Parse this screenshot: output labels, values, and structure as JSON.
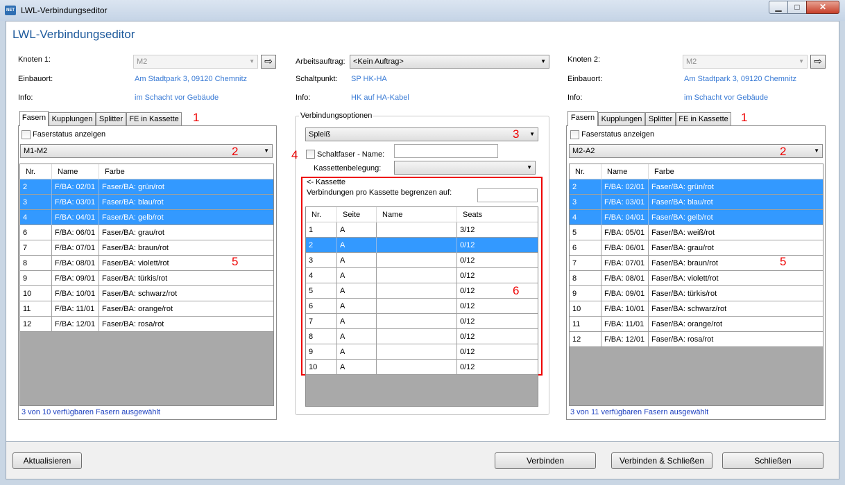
{
  "window": {
    "title": "LWL-Verbindungseditor",
    "icon_text": "NET",
    "min_glyph": "▁",
    "max_glyph": "□",
    "close_glyph": "✕"
  },
  "heading": "LWL-Verbindungseditor",
  "left": {
    "knoten_label": "Knoten 1:",
    "knoten_value": "M2",
    "einbauort_label": "Einbauort:",
    "einbauort_value": "Am Stadtpark 3, 09120 Chemnitz",
    "info_label": "Info:",
    "info_value": "im Schacht vor Gebäude",
    "tabs": [
      "Fasern",
      "Kupplungen",
      "Splitter",
      "FE in Kassette"
    ],
    "faserstatus_label": "Faserstatus anzeigen",
    "dropdown_value": "M1-M2",
    "columns": [
      "Nr.",
      "Name",
      "Farbe"
    ],
    "rows": [
      {
        "nr": "2",
        "name": "F/BA: 02/01",
        "farbe": "Faser/BA: grün/rot",
        "selected": true
      },
      {
        "nr": "3",
        "name": "F/BA: 03/01",
        "farbe": "Faser/BA: blau/rot",
        "selected": true
      },
      {
        "nr": "4",
        "name": "F/BA: 04/01",
        "farbe": "Faser/BA: gelb/rot",
        "selected": true
      },
      {
        "nr": "6",
        "name": "F/BA: 06/01",
        "farbe": "Faser/BA: grau/rot",
        "selected": false
      },
      {
        "nr": "7",
        "name": "F/BA: 07/01",
        "farbe": "Faser/BA: braun/rot",
        "selected": false
      },
      {
        "nr": "8",
        "name": "F/BA: 08/01",
        "farbe": "Faser/BA: violett/rot",
        "selected": false
      },
      {
        "nr": "9",
        "name": "F/BA: 09/01",
        "farbe": "Faser/BA: türkis/rot",
        "selected": false
      },
      {
        "nr": "10",
        "name": "F/BA: 10/01",
        "farbe": "Faser/BA: schwarz/rot",
        "selected": false
      },
      {
        "nr": "11",
        "name": "F/BA: 11/01",
        "farbe": "Faser/BA: orange/rot",
        "selected": false
      },
      {
        "nr": "12",
        "name": "F/BA: 12/01",
        "farbe": "Faser/BA: rosa/rot",
        "selected": false
      }
    ],
    "status": "3 von 10 verfügbaren Fasern ausgewählt"
  },
  "center": {
    "arbeitsauftrag_label": "Arbeitsauftrag:",
    "arbeitsauftrag_value": "<Kein Auftrag>",
    "schaltpunkt_label": "Schaltpunkt:",
    "schaltpunkt_value": "SP HK-HA",
    "info_label": "Info:",
    "info_value": "HK auf HA-Kabel",
    "group_label": "Verbindungsoptionen",
    "type_value": "Spleiß",
    "schaltfaser_label": "Schaltfaser - Name:",
    "schaltfaser_value": "",
    "kassettenbelegung_label": "Kassettenbelegung:",
    "kassettenbelegung_value": "",
    "kassette_group_label": "<- Kassette",
    "limit_label": "Verbindungen pro Kassette begrenzen auf:",
    "limit_value": "",
    "columns": [
      "Nr.",
      "Seite",
      "Name",
      "Seats"
    ],
    "rows": [
      {
        "nr": "1",
        "seite": "A",
        "name": "",
        "seats": "3/12",
        "selected": false
      },
      {
        "nr": "2",
        "seite": "A",
        "name": "",
        "seats": "0/12",
        "selected": true
      },
      {
        "nr": "3",
        "seite": "A",
        "name": "",
        "seats": "0/12",
        "selected": false
      },
      {
        "nr": "4",
        "seite": "A",
        "name": "",
        "seats": "0/12",
        "selected": false
      },
      {
        "nr": "5",
        "seite": "A",
        "name": "",
        "seats": "0/12",
        "selected": false
      },
      {
        "nr": "6",
        "seite": "A",
        "name": "",
        "seats": "0/12",
        "selected": false
      },
      {
        "nr": "7",
        "seite": "A",
        "name": "",
        "seats": "0/12",
        "selected": false
      },
      {
        "nr": "8",
        "seite": "A",
        "name": "",
        "seats": "0/12",
        "selected": false
      },
      {
        "nr": "9",
        "seite": "A",
        "name": "",
        "seats": "0/12",
        "selected": false
      },
      {
        "nr": "10",
        "seite": "A",
        "name": "",
        "seats": "0/12",
        "selected": false
      }
    ]
  },
  "right": {
    "knoten_label": "Knoten 2:",
    "knoten_value": "M2",
    "einbauort_label": "Einbauort:",
    "einbauort_value": "Am Stadtpark 3, 09120 Chemnitz",
    "info_label": "Info:",
    "info_value": "im Schacht vor Gebäude",
    "tabs": [
      "Fasern",
      "Kupplungen",
      "Splitter",
      "FE in Kassette"
    ],
    "faserstatus_label": "Faserstatus anzeigen",
    "dropdown_value": "M2-A2",
    "columns": [
      "Nr.",
      "Name",
      "Farbe"
    ],
    "rows": [
      {
        "nr": "2",
        "name": "F/BA: 02/01",
        "farbe": "Faser/BA: grün/rot",
        "selected": true
      },
      {
        "nr": "3",
        "name": "F/BA: 03/01",
        "farbe": "Faser/BA: blau/rot",
        "selected": true
      },
      {
        "nr": "4",
        "name": "F/BA: 04/01",
        "farbe": "Faser/BA: gelb/rot",
        "selected": true
      },
      {
        "nr": "5",
        "name": "F/BA: 05/01",
        "farbe": "Faser/BA: weiß/rot",
        "selected": false
      },
      {
        "nr": "6",
        "name": "F/BA: 06/01",
        "farbe": "Faser/BA: grau/rot",
        "selected": false
      },
      {
        "nr": "7",
        "name": "F/BA: 07/01",
        "farbe": "Faser/BA: braun/rot",
        "selected": false
      },
      {
        "nr": "8",
        "name": "F/BA: 08/01",
        "farbe": "Faser/BA: violett/rot",
        "selected": false
      },
      {
        "nr": "9",
        "name": "F/BA: 09/01",
        "farbe": "Faser/BA: türkis/rot",
        "selected": false
      },
      {
        "nr": "10",
        "name": "F/BA: 10/01",
        "farbe": "Faser/BA: schwarz/rot",
        "selected": false
      },
      {
        "nr": "11",
        "name": "F/BA: 11/01",
        "farbe": "Faser/BA: orange/rot",
        "selected": false
      },
      {
        "nr": "12",
        "name": "F/BA: 12/01",
        "farbe": "Faser/BA: rosa/rot",
        "selected": false
      }
    ],
    "status": "3 von 11 verfügbaren Fasern ausgewählt"
  },
  "annotations": {
    "n1": "1",
    "n2": "2",
    "n3": "3",
    "n4": "4",
    "n5": "5",
    "n6": "6"
  },
  "buttons": {
    "refresh": "Aktualisieren",
    "connect": "Verbinden",
    "connect_close": "Verbinden & Schließen",
    "close": "Schließen"
  },
  "glyphs": {
    "arrow_down": "▼",
    "arrow_right": "⇨"
  },
  "colors": {
    "selection": "#3399ff",
    "link": "#3a7bd5",
    "heading": "#1e5a9c",
    "annotation": "#ee0000",
    "status": "#1b3fbf"
  }
}
